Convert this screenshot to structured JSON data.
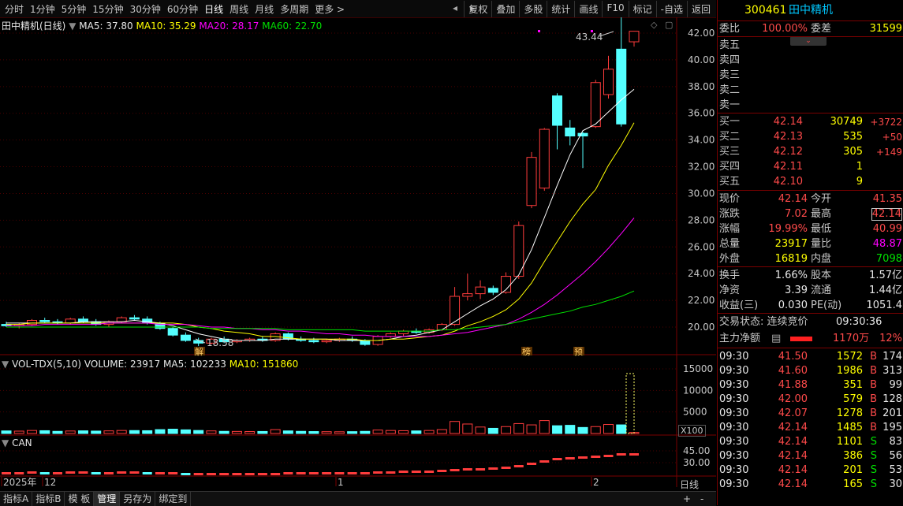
{
  "toolbar": {
    "periods": [
      "分时",
      "1分钟",
      "5分钟",
      "15分钟",
      "30分钟",
      "60分钟",
      "日线",
      "周线",
      "月线",
      "多周期",
      "更多 >"
    ],
    "active_period": "日线",
    "tools": [
      "复权",
      "叠加",
      "多股",
      "统计",
      "画线",
      "F10",
      "标记",
      "-自选",
      "返回"
    ]
  },
  "main_legend": {
    "name": "田中精机(日线)",
    "ma5": "MA5: 37.80",
    "ma10": "MA10: 35.29",
    "ma20": "MA20: 28.17",
    "ma60": "MA60: 22.70"
  },
  "price_axis": [
    "42.00",
    "40.00",
    "38.00",
    "36.00",
    "34.00",
    "32.00",
    "30.00",
    "28.00",
    "26.00",
    "24.00",
    "22.00",
    "20.00"
  ],
  "annotations": {
    "high": "43.44",
    "low": "18.58",
    "tag_jie": "解",
    "tag_bang": "榜",
    "tag_yu": "预"
  },
  "vol_legend": {
    "name": "VOL-TDX(5,10)",
    "volume": "VOLUME: 23917",
    "ma5": "MA5: 102233",
    "ma10": "MA10: 151860"
  },
  "vol_axis": [
    "15000",
    "10000",
    "5000"
  ],
  "vol_unit": "X100",
  "can_legend": {
    "name": "CAN"
  },
  "can_axis": [
    "45.00",
    "30.00"
  ],
  "date_axis": [
    "2025年",
    "12",
    "1",
    "2"
  ],
  "bottom_tabs": [
    "指标A",
    "指标B",
    "模 板",
    "管理",
    "另存为",
    "绑定到"
  ],
  "active_bottom_tab": "管理",
  "period_label": "日线",
  "zoom": [
    "+",
    "-"
  ],
  "chart_data": {
    "type": "candlestick",
    "candles": [
      [
        20.2,
        20.4,
        20.0,
        20.1
      ],
      [
        20.1,
        20.3,
        19.9,
        20.2
      ],
      [
        20.2,
        20.6,
        20.1,
        20.5
      ],
      [
        20.5,
        20.7,
        20.3,
        20.4
      ],
      [
        20.4,
        20.6,
        20.2,
        20.3
      ],
      [
        20.3,
        20.7,
        20.2,
        20.6
      ],
      [
        20.6,
        20.8,
        20.3,
        20.4
      ],
      [
        20.4,
        20.6,
        20.1,
        20.2
      ],
      [
        20.2,
        20.5,
        20.0,
        20.4
      ],
      [
        20.4,
        20.8,
        20.3,
        20.7
      ],
      [
        20.7,
        20.9,
        20.5,
        20.6
      ],
      [
        20.6,
        20.8,
        20.2,
        20.3
      ],
      [
        20.3,
        20.4,
        19.8,
        19.9
      ],
      [
        19.9,
        20.0,
        19.3,
        19.4
      ],
      [
        19.4,
        19.6,
        18.9,
        19.0
      ],
      [
        19.0,
        19.2,
        18.58,
        18.8
      ],
      [
        18.8,
        19.2,
        18.7,
        19.1
      ],
      [
        19.1,
        19.3,
        18.8,
        18.9
      ],
      [
        18.9,
        19.1,
        18.8,
        19.0
      ],
      [
        19.0,
        19.2,
        18.9,
        19.1
      ],
      [
        19.1,
        19.3,
        18.9,
        19.0
      ],
      [
        19.0,
        19.6,
        18.9,
        19.5
      ],
      [
        19.5,
        19.6,
        19.0,
        19.1
      ],
      [
        19.1,
        19.3,
        18.9,
        19.0
      ],
      [
        19.0,
        19.2,
        18.8,
        18.9
      ],
      [
        18.9,
        19.1,
        18.8,
        19.0
      ],
      [
        19.0,
        19.2,
        18.9,
        19.1
      ],
      [
        19.1,
        19.3,
        18.9,
        19.0
      ],
      [
        19.0,
        19.1,
        18.6,
        18.7
      ],
      [
        18.7,
        19.4,
        18.6,
        19.3
      ],
      [
        19.3,
        19.6,
        19.2,
        19.5
      ],
      [
        19.5,
        19.8,
        19.3,
        19.7
      ],
      [
        19.7,
        19.9,
        19.5,
        19.6
      ],
      [
        19.6,
        19.9,
        19.5,
        19.8
      ],
      [
        19.8,
        20.3,
        19.7,
        20.2
      ],
      [
        20.2,
        23.0,
        20.1,
        22.3
      ],
      [
        22.3,
        24.0,
        22.0,
        22.5
      ],
      [
        22.5,
        23.5,
        22.1,
        23.0
      ],
      [
        22.9,
        23.1,
        22.4,
        22.6
      ],
      [
        22.6,
        24.1,
        22.5,
        23.8
      ],
      [
        23.8,
        27.9,
        23.6,
        27.6
      ],
      [
        29.1,
        33.1,
        28.9,
        32.7
      ],
      [
        30.4,
        34.9,
        30.2,
        34.8
      ],
      [
        37.3,
        37.5,
        33.3,
        35.1
      ],
      [
        34.9,
        35.5,
        33.6,
        34.3
      ],
      [
        34.5,
        34.6,
        31.9,
        34.3
      ],
      [
        35.0,
        38.5,
        34.9,
        38.3
      ],
      [
        37.4,
        40.3,
        37.1,
        39.3
      ],
      [
        40.8,
        43.44,
        35.0,
        35.2
      ],
      [
        41.35,
        42.14,
        40.99,
        42.14
      ]
    ],
    "ma5": [
      20.3,
      20.3,
      20.3,
      20.3,
      20.3,
      20.3,
      20.4,
      20.4,
      20.4,
      20.4,
      20.5,
      20.4,
      20.3,
      20.1,
      19.8,
      19.5,
      19.3,
      19.1,
      19.0,
      19.0,
      19.0,
      19.1,
      19.1,
      19.1,
      19.1,
      19.1,
      19.0,
      19.0,
      19.0,
      19.0,
      19.1,
      19.3,
      19.4,
      19.6,
      19.8,
      20.4,
      21.0,
      21.6,
      22.1,
      22.8,
      23.9,
      25.8,
      28.2,
      30.6,
      32.9,
      34.7,
      35.2,
      36.1,
      37.0,
      37.8
    ],
    "ma10": [
      20.2,
      20.2,
      20.3,
      20.3,
      20.3,
      20.3,
      20.3,
      20.3,
      20.3,
      20.3,
      20.3,
      20.3,
      20.3,
      20.3,
      20.2,
      20.0,
      19.9,
      19.7,
      19.6,
      19.5,
      19.3,
      19.3,
      19.2,
      19.1,
      19.1,
      19.1,
      19.1,
      19.1,
      19.0,
      19.0,
      19.1,
      19.1,
      19.2,
      19.3,
      19.4,
      19.7,
      20.1,
      20.4,
      20.8,
      21.3,
      22.1,
      23.3,
      24.9,
      26.4,
      27.9,
      29.2,
      30.3,
      32.1,
      33.6,
      35.29
    ],
    "ma20": [
      20.1,
      20.1,
      20.1,
      20.2,
      20.2,
      20.2,
      20.2,
      20.2,
      20.3,
      20.3,
      20.3,
      20.3,
      20.2,
      20.2,
      20.2,
      20.1,
      20.0,
      20.0,
      19.9,
      19.9,
      19.8,
      19.8,
      19.7,
      19.7,
      19.6,
      19.5,
      19.5,
      19.4,
      19.4,
      19.3,
      19.3,
      19.3,
      19.3,
      19.3,
      19.4,
      19.5,
      19.6,
      19.8,
      20.0,
      20.2,
      20.6,
      21.1,
      21.7,
      22.4,
      23.2,
      24.0,
      24.9,
      25.9,
      27.0,
      28.17
    ],
    "ma60": [
      20.0,
      20.0,
      20.0,
      20.0,
      20.0,
      20.0,
      20.0,
      20.0,
      20.0,
      20.0,
      20.0,
      20.0,
      20.0,
      20.0,
      20.0,
      20.0,
      19.9,
      19.9,
      19.9,
      19.9,
      19.9,
      19.9,
      19.8,
      19.8,
      19.8,
      19.8,
      19.8,
      19.8,
      19.7,
      19.7,
      19.7,
      19.7,
      19.7,
      19.7,
      19.8,
      19.8,
      19.9,
      20.0,
      20.1,
      20.2,
      20.4,
      20.6,
      20.8,
      21.0,
      21.2,
      21.5,
      21.7,
      22.0,
      22.3,
      22.7
    ],
    "volume": [
      600,
      550,
      700,
      650,
      500,
      580,
      620,
      560,
      610,
      700,
      680,
      650,
      900,
      1000,
      850,
      700,
      600,
      500,
      480,
      450,
      470,
      900,
      600,
      500,
      450,
      420,
      400,
      430,
      500,
      800,
      700,
      650,
      600,
      700,
      900,
      2800,
      2200,
      1500,
      1200,
      1600,
      2300,
      2000,
      3000,
      1800,
      1900,
      1400,
      1600,
      2100,
      2000,
      239
    ],
    "can": [
      18,
      18,
      19,
      18,
      18,
      19,
      19,
      18,
      18,
      19,
      19,
      18,
      18,
      18,
      17,
      17,
      17,
      17,
      17,
      17,
      17,
      17,
      18,
      18,
      18,
      18,
      18,
      18,
      18,
      19,
      19,
      20,
      20,
      20,
      21,
      22,
      23,
      23,
      24,
      25,
      27,
      30,
      33,
      36,
      37,
      38,
      39,
      40,
      42,
      42
    ]
  },
  "right": {
    "code": "300461",
    "name": "田中精机",
    "weibi_label": "委比",
    "weibi": "100.00%",
    "weicha_label": "委差",
    "weicha": "31599",
    "asks": [
      "卖五",
      "卖四",
      "卖三",
      "卖二",
      "卖一"
    ],
    "bids": [
      {
        "label": "买一",
        "price": "42.14",
        "vol": "30749",
        "chg": "+3722"
      },
      {
        "label": "买二",
        "price": "42.13",
        "vol": "535",
        "chg": "+50"
      },
      {
        "label": "买三",
        "price": "42.12",
        "vol": "305",
        "chg": "+149"
      },
      {
        "label": "买四",
        "price": "42.11",
        "vol": "1",
        "chg": ""
      },
      {
        "label": "买五",
        "price": "42.10",
        "vol": "9",
        "chg": ""
      }
    ],
    "quote": [
      {
        "l1": "现价",
        "v1": "42.14",
        "l2": "今开",
        "v2": "41.35"
      },
      {
        "l1": "涨跌",
        "v1": "7.02",
        "l2": "最高",
        "v2": "42.14"
      },
      {
        "l1": "涨幅",
        "v1": "19.99%",
        "l2": "最低",
        "v2": "40.99"
      },
      {
        "l1": "总量",
        "v1": "23917",
        "l2": "量比",
        "v2": "48.87"
      },
      {
        "l1": "外盘",
        "v1": "16819",
        "l2": "内盘",
        "v2": "7098"
      }
    ],
    "fund": [
      {
        "l1": "换手",
        "v1": "1.66%",
        "l2": "股本",
        "v2": "1.57亿"
      },
      {
        "l1": "净资",
        "v1": "3.39",
        "l2": "流通",
        "v2": "1.44亿"
      },
      {
        "l1": "收益(三)",
        "v1": "0.030",
        "l2": "PE(动)",
        "v2": "1051.4"
      }
    ],
    "status_label": "交易状态: 连续竞价",
    "status_time": "09:30:36",
    "netflow_label": "主力净额",
    "netflow_value": "1170万",
    "netflow_pct": "12%",
    "ticks": [
      {
        "t": "09:30",
        "p": "41.50",
        "v": "1572",
        "d": "B",
        "n": "174"
      },
      {
        "t": "09:30",
        "p": "41.60",
        "v": "1986",
        "d": "B",
        "n": "313"
      },
      {
        "t": "09:30",
        "p": "41.88",
        "v": "351",
        "d": "B",
        "n": "99"
      },
      {
        "t": "09:30",
        "p": "42.00",
        "v": "579",
        "d": "B",
        "n": "128"
      },
      {
        "t": "09:30",
        "p": "42.07",
        "v": "1278",
        "d": "B",
        "n": "201"
      },
      {
        "t": "09:30",
        "p": "42.14",
        "v": "1485",
        "d": "B",
        "n": "195"
      },
      {
        "t": "09:30",
        "p": "42.14",
        "v": "1101",
        "d": "S",
        "n": "83"
      },
      {
        "t": "09:30",
        "p": "42.14",
        "v": "386",
        "d": "S",
        "n": "56"
      },
      {
        "t": "09:30",
        "p": "42.14",
        "v": "201",
        "d": "S",
        "n": "53"
      },
      {
        "t": "09:30",
        "p": "42.14",
        "v": "165",
        "d": "S",
        "n": "30"
      }
    ]
  }
}
